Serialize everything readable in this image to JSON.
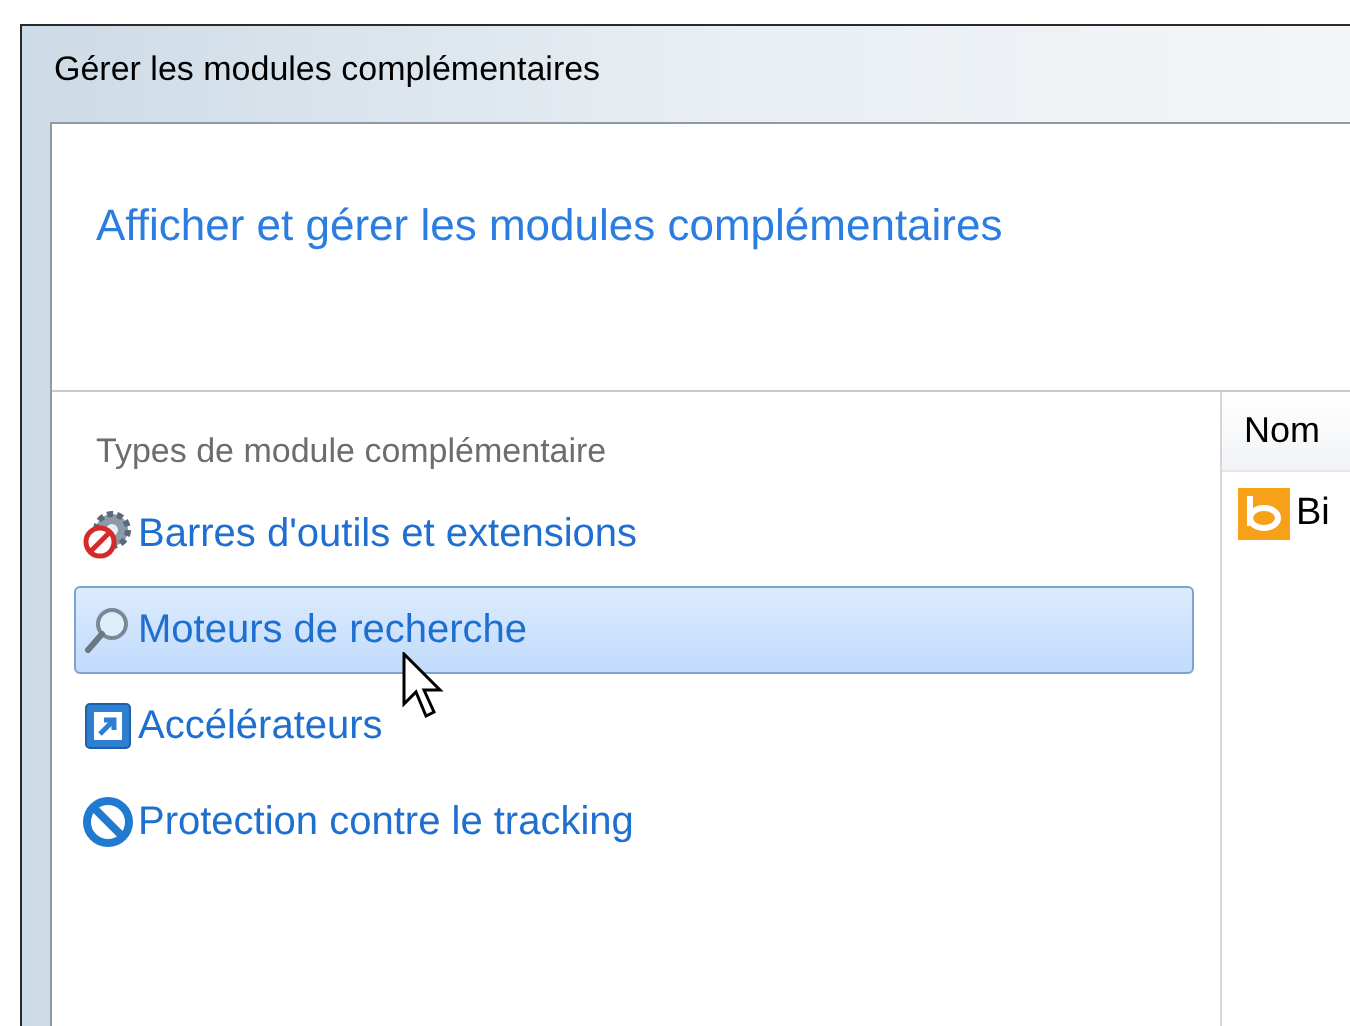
{
  "window": {
    "title": "Gérer les modules complémentaires"
  },
  "heading": "Afficher et gérer les modules complémentaires",
  "sidebar": {
    "title": "Types de module complémentaire",
    "items": [
      {
        "label": "Barres d'outils et extensions",
        "kind": "toolbars",
        "selected": false
      },
      {
        "label": "Moteurs de recherche",
        "kind": "search",
        "selected": true
      },
      {
        "label": "Accélérateurs",
        "kind": "accelerators",
        "selected": false
      },
      {
        "label": "Protection contre le tracking",
        "kind": "tracking",
        "selected": false
      }
    ]
  },
  "list": {
    "columns": [
      "Nom"
    ],
    "rows": [
      {
        "name": "Bi"
      }
    ]
  }
}
